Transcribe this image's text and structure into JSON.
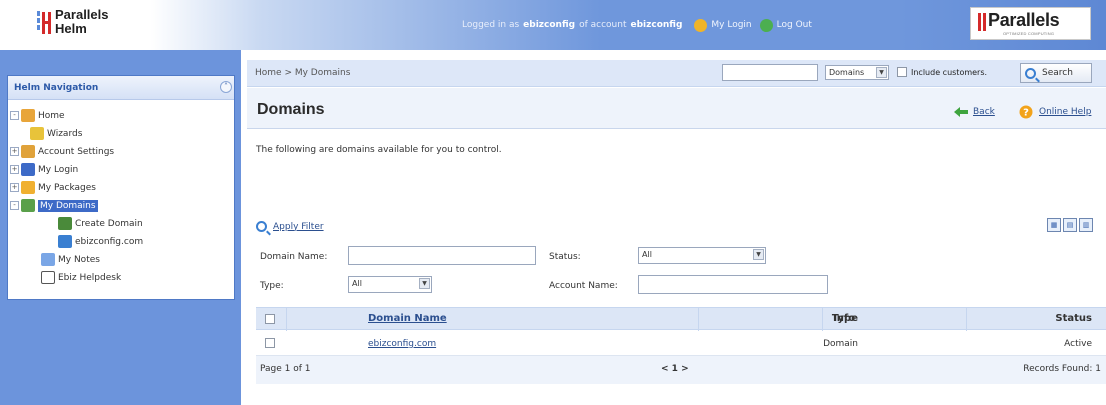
{
  "app": {
    "name": "Parallels Helm",
    "name_line1": "Parallels",
    "name_line2": "Helm"
  },
  "header": {
    "logged_in_as_prefix": "Logged in as",
    "user": "ebizconfig",
    "account_prefix": "of account",
    "account": "ebizconfig",
    "my_login": "My Login",
    "log_out": "Log Out",
    "logo_word": "Parallels",
    "logo_tagline": "OPTIMIZED COMPUTING"
  },
  "nav": {
    "title": "Helm Navigation",
    "items": [
      {
        "label": "Home",
        "expander": "-",
        "icon": "home-icon",
        "color": "#e8a53a"
      },
      {
        "label": "Wizards",
        "expander": "",
        "icon": "wizard-icon",
        "color": "#e8c33a"
      },
      {
        "label": "Account Settings",
        "expander": "+",
        "icon": "account-settings-icon",
        "color": "#e0a23a"
      },
      {
        "label": "My Login",
        "expander": "+",
        "icon": "login-icon",
        "color": "#3d6ac7"
      },
      {
        "label": "My Packages",
        "expander": "+",
        "icon": "packages-icon",
        "color": "#f0b030"
      },
      {
        "label": "My Domains",
        "expander": "-",
        "icon": "domains-icon",
        "color": "#5aa04a"
      },
      {
        "label": "Create Domain",
        "expander": "",
        "icon": "create-domain-icon",
        "color": "#4a8a3a"
      },
      {
        "label": "ebizconfig.com",
        "expander": "",
        "icon": "globe-icon",
        "color": "#3a7fd1"
      },
      {
        "label": "My Notes",
        "expander": "",
        "icon": "notes-icon",
        "color": "#7aa6e6"
      },
      {
        "label": "Ebiz Helpdesk",
        "expander": "",
        "icon": "document-icon",
        "color": "#ffffff"
      }
    ]
  },
  "breadcrumb": "Home > My Domains",
  "search": {
    "value": "",
    "type_selected": "Domains",
    "include_customers_label": "Include customers.",
    "button_label": "Search"
  },
  "page": {
    "title": "Domains",
    "back_label": "Back",
    "help_label": "Online Help",
    "intro": "The following are domains available for you to control."
  },
  "filter": {
    "apply_label": "Apply Filter",
    "domain_name_label": "Domain Name:",
    "domain_name_value": "",
    "status_label": "Status:",
    "status_selected": "All",
    "type_label": "Type:",
    "type_selected": "All",
    "account_name_label": "Account Name:",
    "account_name_value": ""
  },
  "grid": {
    "columns": [
      "Domain Name",
      "Type",
      "Info",
      "Status"
    ],
    "rows": [
      {
        "domain": "ebizconfig.com",
        "type": "Domain",
        "info": "",
        "status": "Active"
      }
    ],
    "page_text": "Page 1 of 1",
    "pager": "< 1 >",
    "records_found": "Records Found: 1"
  },
  "colors": {
    "accent": "#3d6ac7",
    "sidebar": "#6c94dc",
    "header_blue": "#6f97dc",
    "logo_red": "#d42a2a"
  }
}
